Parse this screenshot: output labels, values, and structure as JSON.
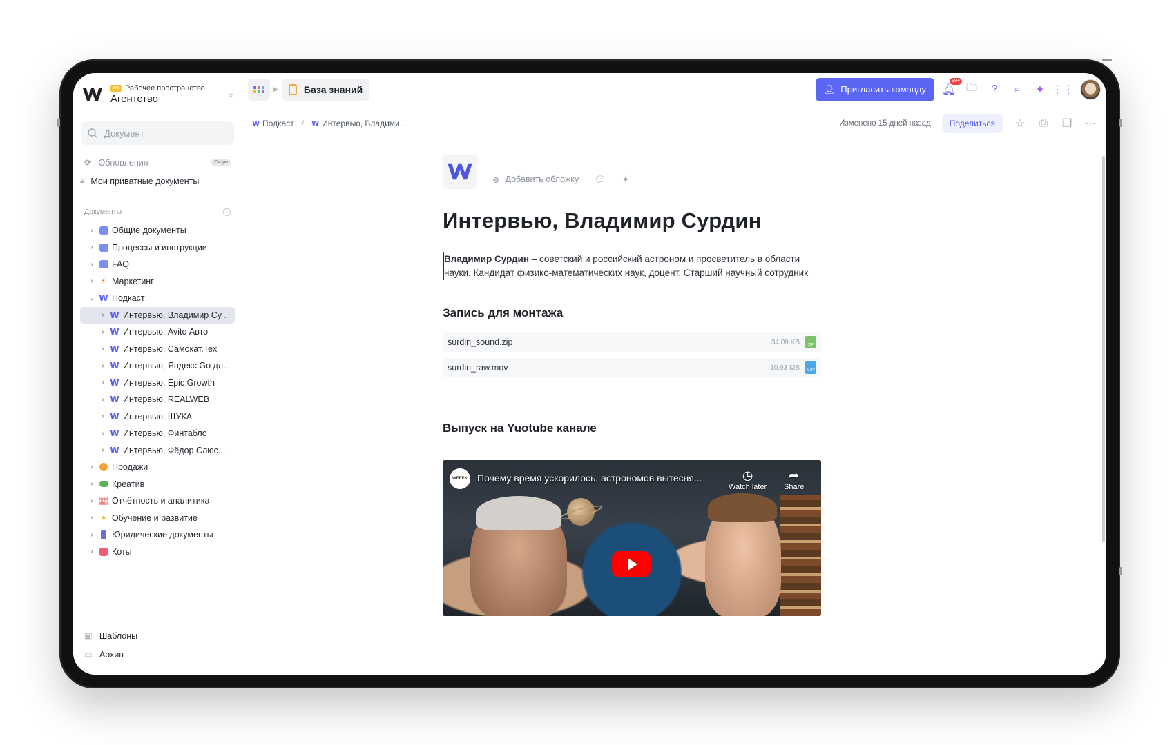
{
  "workspace": {
    "subtitle": "Рабочее пространство",
    "name": "Агентство",
    "badge": "WE"
  },
  "sidebar": {
    "search_placeholder": "Документ",
    "updates": "Обновления",
    "updates_badge": "Скоро",
    "private": "Мои приватные документы",
    "docs_header": "Документы",
    "tree": [
      {
        "label": "Общие документы",
        "icon": "folder-icon"
      },
      {
        "label": "Процессы и инструкции",
        "icon": "folder-icon"
      },
      {
        "label": "FAQ",
        "icon": "folder-icon"
      },
      {
        "label": "Маркетинг",
        "icon": "lightning-icon"
      },
      {
        "label": "Подкаст",
        "icon": "w-logo-icon",
        "expanded": true
      },
      {
        "label": "Интервью, Владимир Су...",
        "icon": "w-logo-icon",
        "active": true
      },
      {
        "label": "Интервью, Avito Авто",
        "icon": "w-logo-icon"
      },
      {
        "label": "Интервью, Самокат.Tex",
        "icon": "w-logo-icon"
      },
      {
        "label": "Интервью, Яндекс Go дл...",
        "icon": "w-logo-icon"
      },
      {
        "label": "Интервью, Epic Growth",
        "icon": "w-logo-icon"
      },
      {
        "label": "Интервью, REALWEB",
        "icon": "w-logo-icon"
      },
      {
        "label": "Интервью, ЩУКА",
        "icon": "w-logo-icon"
      },
      {
        "label": "Интервью, Финтабло",
        "icon": "w-logo-icon"
      },
      {
        "label": "Интервью, Фёдор Слюс...",
        "icon": "w-logo-icon"
      },
      {
        "label": "Продажи",
        "icon": "coin-icon"
      },
      {
        "label": "Креатив",
        "icon": "frog-icon"
      },
      {
        "label": "Отчётность и аналитика",
        "icon": "chart-icon"
      },
      {
        "label": "Обучение и развитие",
        "icon": "star-icon"
      },
      {
        "label": "Юридические документы",
        "icon": "bottle-icon"
      },
      {
        "label": "Коты",
        "icon": "cat-icon"
      }
    ],
    "templates": "Шаблоны",
    "archive": "Архив"
  },
  "topbar": {
    "kb_label": "База знаний",
    "invite_label": "Пригласить команду",
    "notif_badge": "99+"
  },
  "breadcrumb": {
    "root": "Подкаст",
    "current": "Интервью, Владими..."
  },
  "subbar": {
    "changed": "Изменено 15 дней назад",
    "share_label": "Поделиться"
  },
  "doc": {
    "add_cover": "Добавить обложку",
    "title": "Интервью, Владимир Сурдин",
    "para_bold": "Владимир Сурдин",
    "para_rest": " – советский и российский астроном и просветитель в области науки. Кандидат физико-математических наук, доцент. Старший научный сотрудник",
    "h_record": "Запись для монтажа",
    "files": [
      {
        "name": "surdin_sound.zip",
        "size": "34.09 KB",
        "type": "ZIP",
        "color": "#7cc36a"
      },
      {
        "name": "surdin_raw.mov",
        "size": "10.93 MB",
        "type": "MOV",
        "color": "#4fa6e6"
      }
    ],
    "h_youtube": "Выпуск на Yuotube канале",
    "video": {
      "title": "Почему время ускорилось, астрономов вытесня...",
      "channel": "WEEEK",
      "watch_later": "Watch later",
      "share": "Share"
    }
  }
}
